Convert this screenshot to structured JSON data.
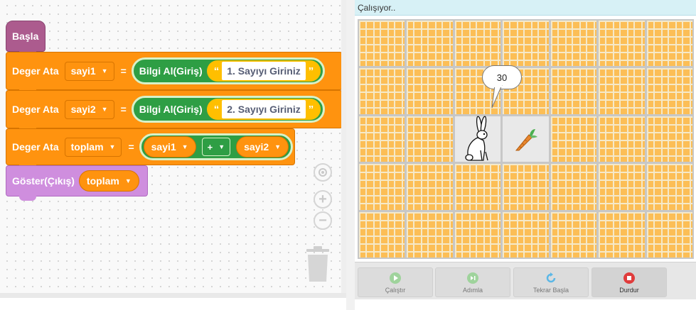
{
  "workspace": {
    "hat_block": {
      "label": "Başla"
    },
    "assign_blocks": [
      {
        "label": "Deger Ata",
        "variable": "sayi1",
        "equals": "=",
        "input_label": "Bilgi Al(Giriş)",
        "prompt": "1. Sayıyı Giriniz"
      },
      {
        "label": "Deger Ata",
        "variable": "sayi2",
        "equals": "=",
        "input_label": "Bilgi Al(Giriş)",
        "prompt": "2. Sayıyı Giriniz"
      }
    ],
    "sum_block": {
      "label": "Deger Ata",
      "variable": "toplam",
      "equals": "=",
      "left": "sayi1",
      "operator": "+",
      "right": "sayi2"
    },
    "output_block": {
      "label": "Göster(Çıkış)",
      "variable": "toplam"
    },
    "quote_open": "“",
    "quote_close": "”",
    "dropdown_glyph": "▼",
    "controls": {
      "zoom_in": "+",
      "zoom_out": "−"
    }
  },
  "stage": {
    "status_text": "Çalışıyor..",
    "bubble_text": "30",
    "grid": {
      "cols": 7,
      "rows": 5,
      "path_cells": [
        "2,2",
        "3,2"
      ]
    },
    "sprites": [
      "rabbit-icon",
      "carrot-icon"
    ]
  },
  "buttons": [
    {
      "label": "Çalıştır",
      "icon": "play-icon"
    },
    {
      "label": "Adımla",
      "icon": "step-icon"
    },
    {
      "label": "Tekrar Başla",
      "icon": "restart-icon"
    },
    {
      "label": "Durdur",
      "icon": "stop-icon"
    }
  ],
  "colors": {
    "event": "#ac5b8e",
    "variable": "#ff930f",
    "output": "#cf8ede",
    "input": "#2e9e44",
    "text": "#ffbf00",
    "stop": "#e03c3c",
    "wall": "#fcbe56"
  }
}
